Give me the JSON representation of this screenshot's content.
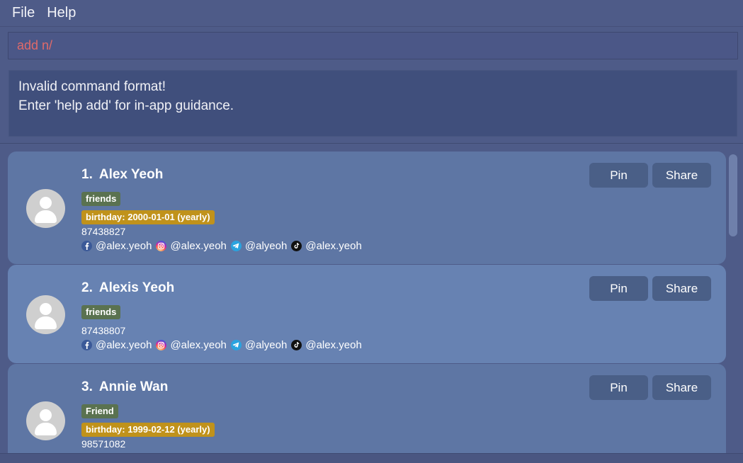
{
  "menubar": {
    "items": [
      "File",
      "Help"
    ]
  },
  "command": {
    "value": "add n/"
  },
  "result": {
    "line1": "Invalid command format!",
    "line2": "Enter 'help add' for in-app guidance."
  },
  "buttons": {
    "pin": "Pin",
    "share": "Share"
  },
  "persons": [
    {
      "index": "1.",
      "name": "Alex Yeoh",
      "tags": [
        "friends"
      ],
      "birthday": "birthday: 2000-01-01 (yearly)",
      "phone": "87438827",
      "socials": [
        {
          "icon": "facebook-icon",
          "handle": "@alex.yeoh"
        },
        {
          "icon": "instagram-icon",
          "handle": "@alex.yeoh"
        },
        {
          "icon": "telegram-icon",
          "handle": "@alyeoh"
        },
        {
          "icon": "tiktok-icon",
          "handle": "@alex.yeoh"
        }
      ]
    },
    {
      "index": "2.",
      "name": "Alexis Yeoh",
      "tags": [
        "friends"
      ],
      "birthday": null,
      "phone": "87438807",
      "socials": [
        {
          "icon": "facebook-icon",
          "handle": "@alex.yeoh"
        },
        {
          "icon": "instagram-icon",
          "handle": "@alex.yeoh"
        },
        {
          "icon": "telegram-icon",
          "handle": "@alyeoh"
        },
        {
          "icon": "tiktok-icon",
          "handle": "@alex.yeoh"
        }
      ]
    },
    {
      "index": "3.",
      "name": "Annie Wan",
      "tags": [
        "Friend"
      ],
      "birthday": "birthday: 1999-02-12 (yearly)",
      "phone": "98571082",
      "socials": []
    }
  ],
  "colors": {
    "background": "#4e5b88",
    "card": "#5e76a4",
    "card_alt": "#6782b2",
    "tag_green": "#5a7250",
    "tag_gold": "#c0921b",
    "command_text": "#e06a6a",
    "button": "#4a5f87"
  }
}
